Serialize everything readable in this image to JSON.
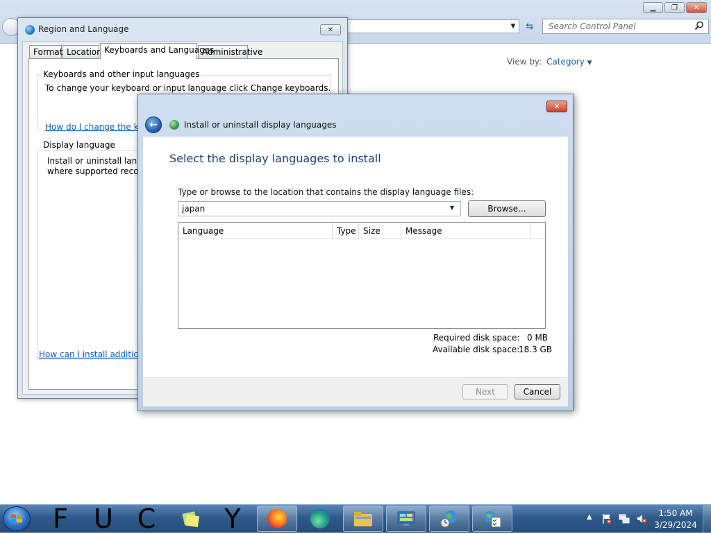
{
  "control_panel": {
    "search_placeholder": "Search Control Panel",
    "view_by_label": "View by:",
    "view_by_value": "Category"
  },
  "region_dialog": {
    "title": "Region and Language",
    "tabs": [
      {
        "label": "Formats"
      },
      {
        "label": "Location"
      },
      {
        "label": "Keyboards and Languages",
        "selected": true
      },
      {
        "label": "Administrative"
      }
    ],
    "group1_title": "Keyboards and other input languages",
    "group1_text": "To change your keyboard or input language click Change keyboards.",
    "group1_link": "How do I change the keyb",
    "group2_title": "Display language",
    "group2_text1": "Install or uninstall langua",
    "group2_text2": "where supported recogn",
    "bottom_link": "How can I install additional"
  },
  "install_dialog": {
    "title": "Install or uninstall display languages",
    "heading": "Select the display languages to install",
    "instruction": "Type or browse to the location that contains the display language files:",
    "path_value": "japan",
    "browse_label": "Browse...",
    "columns": [
      "Language",
      "Type",
      "Size",
      "Message"
    ],
    "rows": [],
    "required_label": "Required disk space:",
    "required_value": "0 MB",
    "available_label": "Available disk space:",
    "available_value": "18.3 GB",
    "next_label": "Next",
    "cancel_label": "Cancel"
  },
  "taskbar": {
    "letters": [
      "F",
      "U",
      "C",
      "Y"
    ],
    "time": "1:50 AM",
    "date": "3/29/2024"
  },
  "colors": {
    "accent": "#1e3f7a",
    "link": "#0d5bc6",
    "taskbar": "#2e5b8c"
  }
}
